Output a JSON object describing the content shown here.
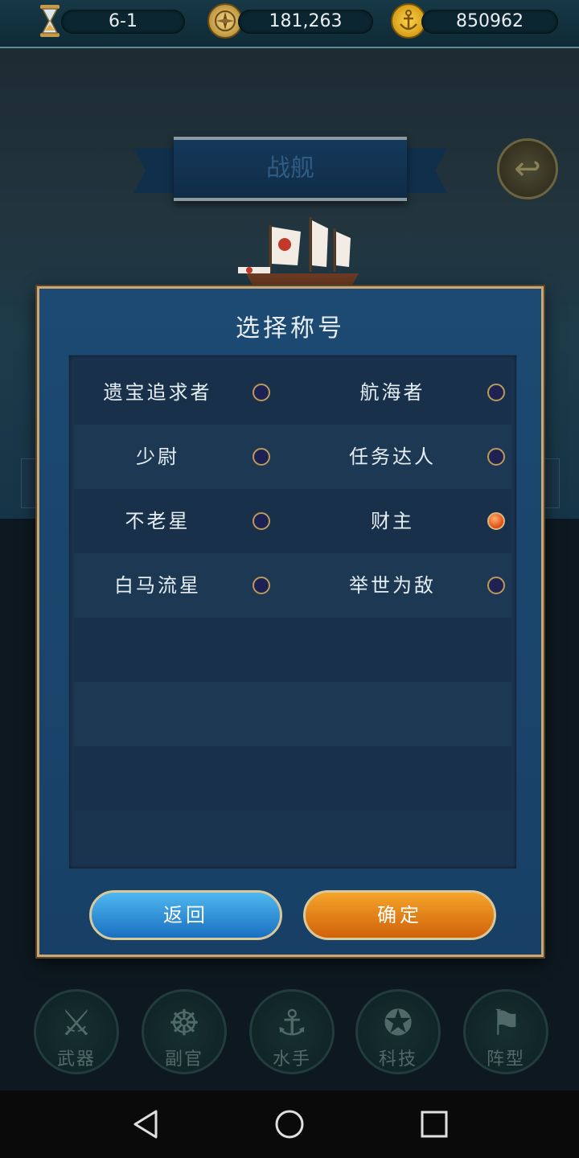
{
  "topbar": {
    "stage": "6-1",
    "power": "181,263",
    "gold": "850962",
    "icons": [
      "hourglass-icon",
      "compass-coin-icon",
      "anchor-coin-icon"
    ]
  },
  "scene": {
    "banner_title": "战舰",
    "back_icon": "return-arrow-icon"
  },
  "dialog": {
    "title": "选择称号",
    "options": [
      {
        "label": "遗宝追求者",
        "selected": false
      },
      {
        "label": "航海者",
        "selected": false
      },
      {
        "label": "少尉",
        "selected": false
      },
      {
        "label": "任务达人",
        "selected": false
      },
      {
        "label": "不老星",
        "selected": false
      },
      {
        "label": "财主",
        "selected": true
      },
      {
        "label": "白马流星",
        "selected": false
      },
      {
        "label": "举世为敌",
        "selected": false
      }
    ],
    "back_label": "返回",
    "confirm_label": "确定"
  },
  "bottom_menu": [
    {
      "label": "武器",
      "icon": "sword-icon"
    },
    {
      "label": "副官",
      "icon": "ship-wheel-icon"
    },
    {
      "label": "水手",
      "icon": "hook-icon"
    },
    {
      "label": "科技",
      "icon": "compass-icon"
    },
    {
      "label": "阵型",
      "icon": "flag-icon"
    }
  ],
  "colors": {
    "dialog_bg": "#1c4a72",
    "dialog_border": "#c8a879",
    "back_button": "#2a8ad8",
    "confirm_button": "#e8860f",
    "radio_selected": "#e04a10"
  }
}
